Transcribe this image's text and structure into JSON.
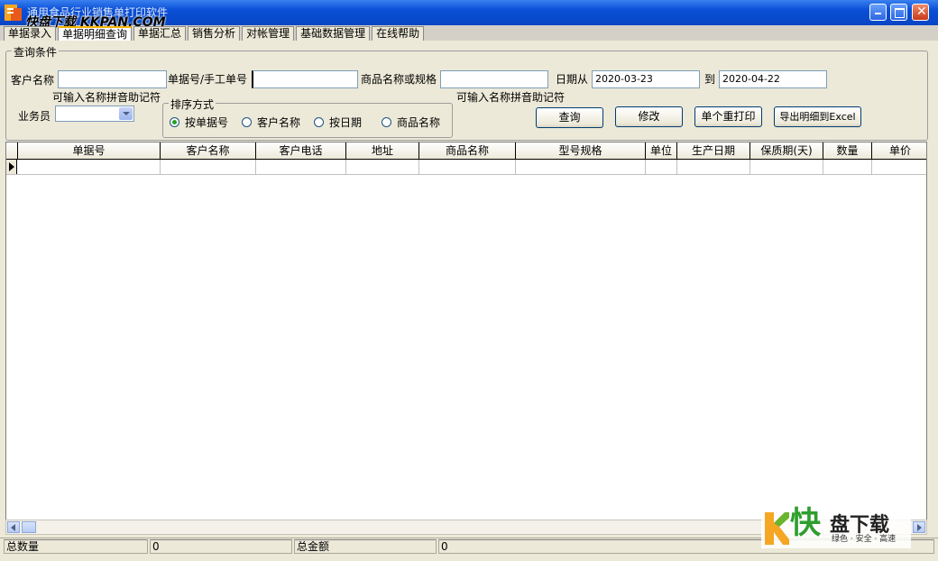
{
  "window": {
    "title": "通用食品行业销售单打印软件",
    "watermark": "快盘下载 KKPAN.COM",
    "buttons": [
      "minimize-icon",
      "maximize-icon",
      "close-icon"
    ]
  },
  "tabs": [
    "单据录入",
    "单据明细查询",
    "单据汇总",
    "销售分析",
    "对帐管理",
    "基础数据管理",
    "在线帮助"
  ],
  "query": {
    "group_title": "查询条件",
    "customer_label": "客户名称",
    "customer_value": "",
    "order_label": "单据号/手工单号",
    "order_value": "",
    "product_label": "商品名称或规格",
    "product_value": "",
    "date_from_label": "日期从",
    "date_from": "2020-03-23",
    "date_to_label": "到",
    "date_to": "2020-04-22",
    "hint_customer": "可输入名称拼音助记符",
    "hint_product": "可输入名称拼音助记符",
    "salesman_label": "业务员",
    "salesman_value": "",
    "sort_title": "排序方式",
    "sort_options": [
      "按单据号",
      "客户名称",
      "按日期",
      "商品名称"
    ],
    "sort_selected": 0,
    "buttons": {
      "query": "查询",
      "edit": "修改",
      "reprint": "单个重打印",
      "export": "导出明细到Excel"
    }
  },
  "table": {
    "columns": [
      "单据号",
      "客户名称",
      "客户电话",
      "地址",
      "商品名称",
      "型号规格",
      "单位",
      "生产日期",
      "保质期(天)",
      "数量",
      "单价"
    ],
    "rows": [
      [
        "",
        "",
        "",
        "",
        "",
        "",
        "",
        "",
        "",
        "",
        ""
      ]
    ]
  },
  "status": {
    "total_qty_label": "总数量",
    "total_qty": "0",
    "total_amount_label": "总金额",
    "total_amount": "0"
  },
  "watermark_br": {
    "logo_char": "快",
    "brand": "盘下载",
    "slogan": "绿色 · 安全 · 高速"
  },
  "colors": {
    "titlebar": "#0a4fd6",
    "panel": "#ece9d8",
    "radio_dot": "#21a121"
  }
}
